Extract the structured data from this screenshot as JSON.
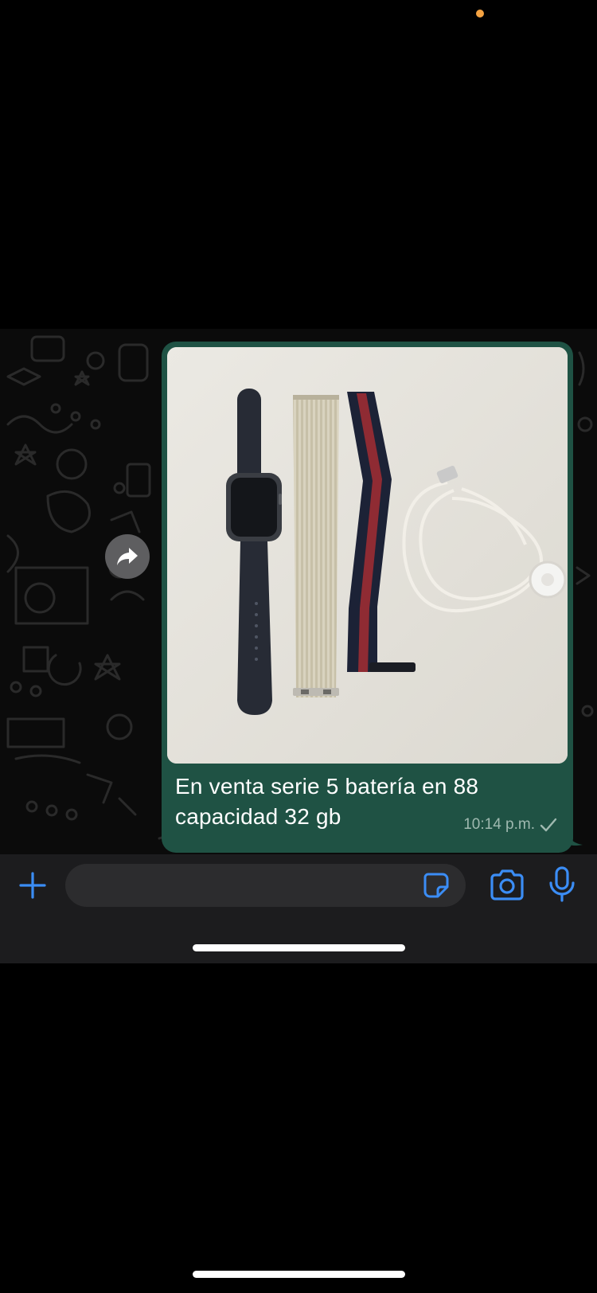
{
  "colors": {
    "outgoing_bubble": "#1f5244",
    "accent_blue": "#3b8df5",
    "chat_background": "#0b0b0b",
    "input_bar": "#1c1c1e",
    "privacy_indicator": "#f5a342"
  },
  "message": {
    "caption": "En venta serie 5 batería en 88 capacidad 32 gb",
    "time": "10:14 p.m.",
    "status_icon": "single-check-icon",
    "photo_icon": "product-photo-apple-watch-bands-charger"
  },
  "forward": {
    "icon": "forward-arrow-icon"
  },
  "composer": {
    "value": "",
    "placeholder": "",
    "icons": [
      "plus-icon",
      "sticker-icon",
      "camera-icon",
      "microphone-icon"
    ]
  }
}
